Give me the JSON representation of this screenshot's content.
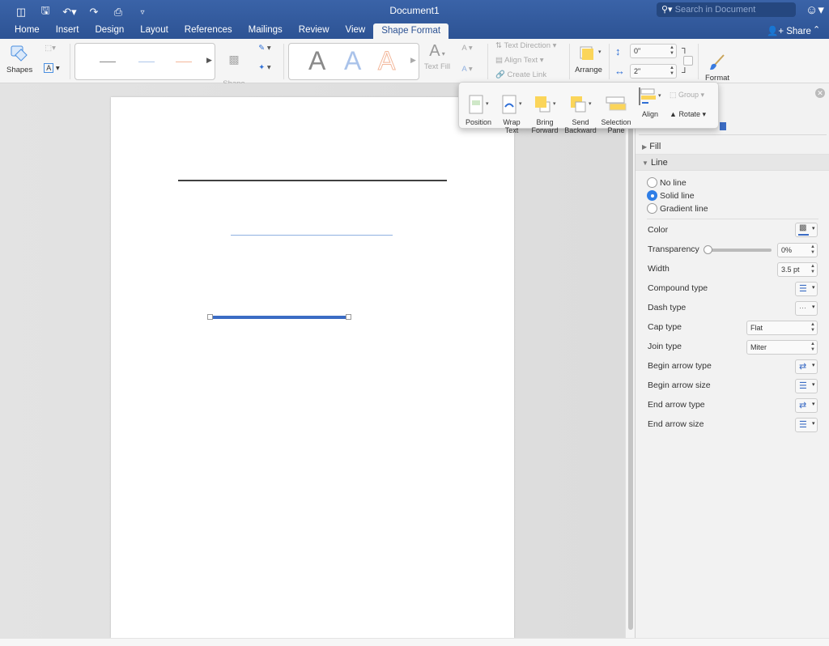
{
  "window": {
    "title": "Document1"
  },
  "toolbar_icons": [
    "sidebar-icon",
    "save-icon",
    "undo-icon",
    "redo-icon",
    "print-icon",
    "customize-icon"
  ],
  "search": {
    "placeholder": "Search in Document"
  },
  "tabs": [
    {
      "label": "Home"
    },
    {
      "label": "Insert"
    },
    {
      "label": "Design"
    },
    {
      "label": "Layout"
    },
    {
      "label": "References"
    },
    {
      "label": "Mailings"
    },
    {
      "label": "Review"
    },
    {
      "label": "View"
    },
    {
      "label": "Shape Format",
      "active": true
    }
  ],
  "share": {
    "label": "Share"
  },
  "ribbon": {
    "shapes_label": "Shapes",
    "shape_fill_label": "Shape\nFill",
    "text_fill_label": "Text Fill",
    "text_direction": "Text Direction",
    "align_text": "Align Text",
    "create_link": "Create Link",
    "arrange_label": "Arrange",
    "height_value": "0\"",
    "width_value": "2\"",
    "format_pane_label": "Format\nPane",
    "line_styles": [
      {
        "color": "#888888"
      },
      {
        "color": "#aec6ea"
      },
      {
        "color": "#f3b79a"
      }
    ],
    "wordart_styles": [
      {
        "color": "#8a8a8a"
      },
      {
        "color": "#aac3ea"
      },
      {
        "color": "#f3b79a"
      }
    ]
  },
  "arrange_popup": {
    "items": [
      {
        "label": "Position"
      },
      {
        "label": "Wrap\nText"
      },
      {
        "label": "Bring\nForward"
      },
      {
        "label": "Send\nBackward"
      },
      {
        "label": "Selection\nPane"
      },
      {
        "label": "Align"
      }
    ],
    "group_label": "Group",
    "rotate_label": "Rotate"
  },
  "format_pane": {
    "fill_label": "Fill",
    "line_label": "Line",
    "line_options": [
      {
        "label": "No line",
        "selected": false
      },
      {
        "label": "Solid line",
        "selected": true
      },
      {
        "label": "Gradient line",
        "selected": false
      }
    ],
    "color_label": "Color",
    "color_value": "#3b6cc4",
    "transparency_label": "Transparency",
    "transparency_value": "0%",
    "transparency_fraction": 0,
    "width_label": "Width",
    "width_value": "3.5 pt",
    "compound_label": "Compound type",
    "dash_label": "Dash type",
    "cap_label": "Cap type",
    "cap_value": "Flat",
    "join_label": "Join type",
    "join_value": "Miter",
    "begin_arrow_type_label": "Begin arrow type",
    "begin_arrow_size_label": "Begin arrow size",
    "end_arrow_type_label": "End arrow type",
    "end_arrow_size_label": "End arrow size"
  },
  "document": {
    "lines": [
      {
        "name": "line-black",
        "color": "#404040"
      },
      {
        "name": "line-light-blue",
        "color": "#8fb0e0"
      },
      {
        "name": "line-selected-blue",
        "color": "#3b6cc4",
        "selected": true
      }
    ]
  }
}
